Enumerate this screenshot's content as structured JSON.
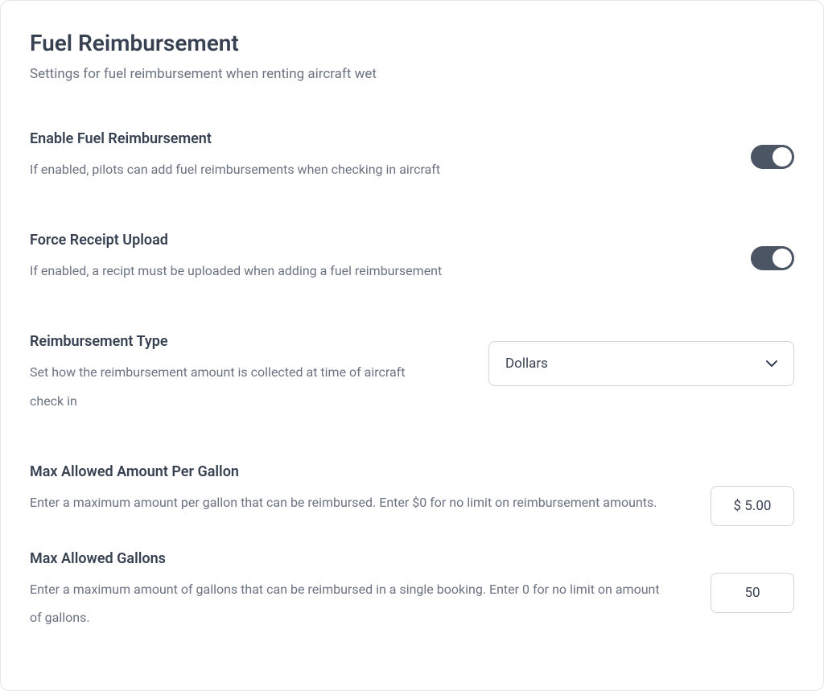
{
  "header": {
    "title": "Fuel Reimbursement",
    "subtitle": "Settings for fuel reimbursement when renting aircraft wet"
  },
  "settings": {
    "enable": {
      "label": "Enable Fuel Reimbursement",
      "desc": "If enabled, pilots can add fuel reimbursements when checking in aircraft",
      "on": true
    },
    "forceReceipt": {
      "label": "Force Receipt Upload",
      "desc": "If enabled, a recipt must be uploaded when adding a fuel reimbursement",
      "on": true
    },
    "type": {
      "label": "Reimbursement Type",
      "desc": "Set how the reimbursement amount is collected at time of aircraft check in",
      "value": "Dollars"
    },
    "maxPerGallon": {
      "label": "Max Allowed Amount Per Gallon",
      "desc": "Enter a maximum amount per gallon that can be reimbursed. Enter $0 for no limit on reimbursement amounts.",
      "value": "$ 5.00"
    },
    "maxGallons": {
      "label": "Max Allowed Gallons",
      "desc": "Enter a maximum amount of gallons that can be reimbursed in a single booking. Enter 0 for no limit on amount of gallons.",
      "value": "50"
    }
  }
}
